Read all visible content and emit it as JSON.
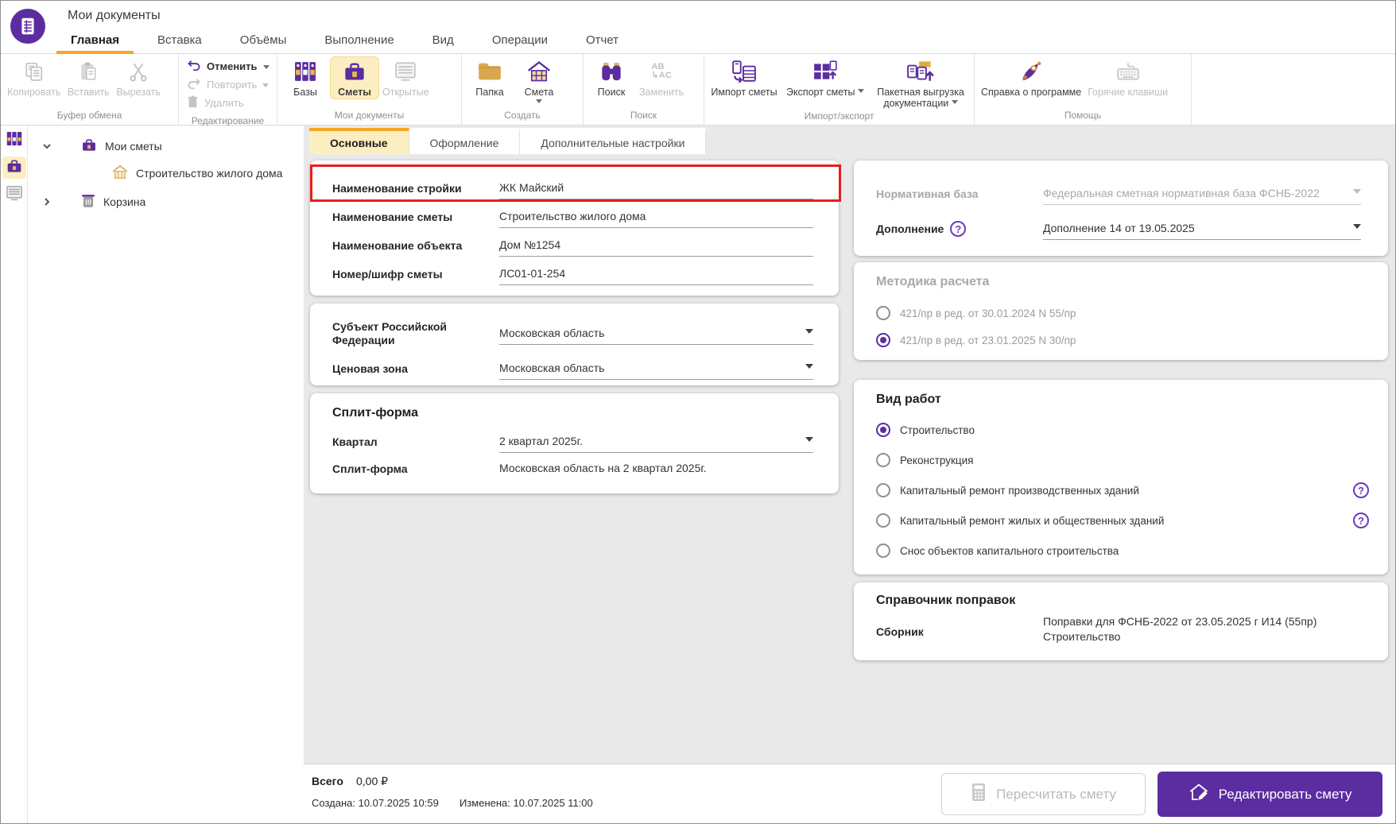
{
  "colors": {
    "accent_purple": "#5b2da0",
    "accent_orange": "#f5a623",
    "highlight_cream": "#fdeec2",
    "annotation_red": "#e51f1c",
    "content_bg": "#e9e9e9"
  },
  "header": {
    "title": "Мои документы",
    "menu": [
      "Главная",
      "Вставка",
      "Объёмы",
      "Выполнение",
      "Вид",
      "Операции",
      "Отчет"
    ]
  },
  "ribbon": {
    "clipboard": {
      "label": "Буфер обмена",
      "copy": "Копировать",
      "paste": "Вставить",
      "cut": "Вырезать"
    },
    "editing": {
      "label": "Редактирование",
      "undo": "Отменить",
      "redo": "Повторить",
      "delete": "Удалить"
    },
    "docs": {
      "label": "Мои документы",
      "bases": "Базы",
      "estimates": "Сметы",
      "open": "Открытые"
    },
    "create": {
      "label": "Создать",
      "folder": "Папка",
      "estimate": "Смета"
    },
    "search": {
      "label": "Поиск",
      "find": "Поиск",
      "replace": "Заменить"
    },
    "import_export": {
      "label": "Импорт/экспорт",
      "import": "Импорт сметы",
      "export": "Экспорт сметы",
      "batch": "Пакетная выгрузка документации"
    },
    "help": {
      "label": "Помощь",
      "about": "Справка о программе",
      "hotkeys": "Горячие клавиши"
    }
  },
  "icons": {
    "help_glyph": "?",
    "replace_line1": "AB",
    "replace_line2": "↳AC"
  },
  "sidebar": {
    "tree": {
      "my_estimates": "Мои сметы",
      "estimate_item": "Строительство жилого дома",
      "trash": "Корзина"
    }
  },
  "tabs": {
    "main": "Основные",
    "design": "Оформление",
    "extra": "Дополнительные настройки"
  },
  "form": {
    "construction_name": {
      "label": "Наименование стройки",
      "value": "ЖК Майский"
    },
    "estimate_name": {
      "label": "Наименование сметы",
      "value": "Строительство жилого дома"
    },
    "object_name": {
      "label": "Наименование объекта",
      "value": "Дом №1254"
    },
    "estimate_code": {
      "label": "Номер/шифр сметы",
      "value": "ЛС01-01-254"
    },
    "region": {
      "label": "Субъект Российской Федерации",
      "value": "Московская область"
    },
    "price_zone": {
      "label": "Ценовая зона",
      "value": "Московская область"
    },
    "split_form": {
      "title": "Сплит-форма",
      "quarter": {
        "label": "Квартал",
        "value": "2 квартал 2025г."
      },
      "split": {
        "label": "Сплит-форма",
        "value": "Московская область на 2 квартал 2025г."
      }
    }
  },
  "right_panel": {
    "normative_base": {
      "label": "Нормативная база",
      "value": "Федеральная сметная нормативная база ФСНБ-2022",
      "disabled": true
    },
    "supplement": {
      "label": "Дополнение",
      "value": "Дополнение 14 от 19.05.2025"
    },
    "method": {
      "title": "Методика расчета",
      "options": [
        {
          "label": "421/пр в ред. от 30.01.2024 N 55/пр",
          "selected": false
        },
        {
          "label": "421/пр в ред. от 23.01.2025 N 30/пр",
          "selected": true
        }
      ]
    },
    "work_type": {
      "title": "Вид работ",
      "options": [
        {
          "label": "Строительство",
          "selected": true
        },
        {
          "label": "Реконструкция",
          "selected": false
        },
        {
          "label": "Капитальный ремонт производственных зданий",
          "selected": false,
          "help": true
        },
        {
          "label": "Капитальный ремонт жилых и общественных зданий",
          "selected": false,
          "help": true
        },
        {
          "label": "Снос объектов капитального строительства",
          "selected": false
        }
      ]
    },
    "corrections": {
      "title": "Справочник поправок",
      "label": "Сборник",
      "value": "Поправки для ФСНБ-2022 от 23.05.2025 г И14 (55пр) Строительство"
    }
  },
  "footer": {
    "total_label": "Всего",
    "total_value": "0,00 ₽",
    "created": "Создана: 10.07.2025 10:59",
    "modified": "Изменена: 10.07.2025 11:00",
    "recalc_button": "Пересчитать смету",
    "edit_button": "Редактировать смету"
  }
}
